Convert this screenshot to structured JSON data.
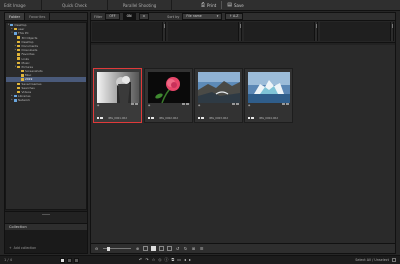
{
  "modes": [
    "Edit Image",
    "Quick Check",
    "Parallel Shooting"
  ],
  "toolbar": {
    "print_label": "Print",
    "save_label": "Save"
  },
  "left": {
    "tabs": [
      "Folder",
      "Favorites"
    ],
    "tree": [
      {
        "label": "Desktop",
        "depth": 0,
        "exp": "▾",
        "sys": true
      },
      {
        "label": "user",
        "depth": 1,
        "exp": "▸"
      },
      {
        "label": "This PC",
        "depth": 1,
        "exp": "▾",
        "sys": true
      },
      {
        "label": "3D Objects",
        "depth": 2,
        "exp": ""
      },
      {
        "label": "Desktop",
        "depth": 2,
        "exp": ""
      },
      {
        "label": "Documents",
        "depth": 2,
        "exp": "▸"
      },
      {
        "label": "Downloads",
        "depth": 2,
        "exp": "▸"
      },
      {
        "label": "Favorites",
        "depth": 2,
        "exp": ""
      },
      {
        "label": "Links",
        "depth": 2,
        "exp": ""
      },
      {
        "label": "Music",
        "depth": 2,
        "exp": ""
      },
      {
        "label": "Pictures",
        "depth": 2,
        "exp": "▾"
      },
      {
        "label": "Screenshots",
        "depth": 3,
        "exp": ""
      },
      {
        "label": "Misc",
        "depth": 3,
        "exp": ""
      },
      {
        "label": "2019",
        "depth": 3,
        "exp": "",
        "sel": true
      },
      {
        "label": "Saved Games",
        "depth": 2,
        "exp": ""
      },
      {
        "label": "Searches",
        "depth": 2,
        "exp": ""
      },
      {
        "label": "Videos",
        "depth": 2,
        "exp": ""
      },
      {
        "label": "Libraries",
        "depth": 1,
        "exp": "▸",
        "sys": true
      },
      {
        "label": "Network",
        "depth": 1,
        "exp": "▸",
        "sys": true
      }
    ],
    "collection_title": "Collection",
    "add_collection": "Add collection"
  },
  "filter": {
    "filter_label": "Filter",
    "btn_off": "OFF",
    "btn_on": "ON",
    "sort_label": "Sort by",
    "sort_value": "File name",
    "sort_order": "↑ A-Z"
  },
  "thumbnails": [
    {
      "name": "IMG_0001.CR2",
      "meta": "2.5\nF5.6\nISO100",
      "selected": true
    },
    {
      "name": "IMG_0002.CR2",
      "meta": "2.5\nF5.6\nISO100",
      "selected": false
    },
    {
      "name": "IMG_0003.CR2",
      "meta": "2.5\nF5.6\nISO100",
      "selected": false
    },
    {
      "name": "IMG_0004.CR2",
      "meta": "2.5\nF5.6\nISO100",
      "selected": false
    }
  ],
  "status": {
    "count": "1 / 4",
    "right_text": "Select All / Unselect"
  }
}
